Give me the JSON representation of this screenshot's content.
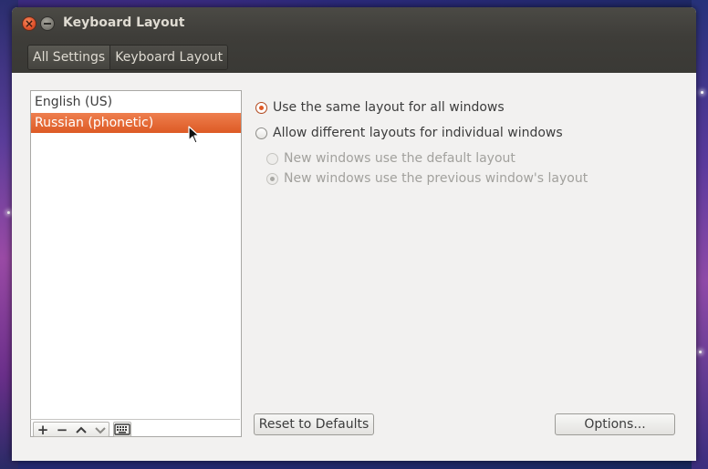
{
  "window": {
    "title": "Keyboard Layout",
    "controls": {
      "close_glyph": "×"
    }
  },
  "breadcrumb": [
    {
      "label": "All Settings"
    },
    {
      "label": "Keyboard Layout"
    }
  ],
  "layouts": {
    "items": [
      {
        "label": "English (US)",
        "selected": false
      },
      {
        "label": "Russian (phonetic)",
        "selected": true
      }
    ],
    "toolbar": {
      "add_label": "+",
      "remove_label": "−",
      "up_label": "⌃",
      "down_label": "⌄"
    }
  },
  "options": {
    "same_layout": {
      "label": "Use the same layout for all windows",
      "checked": true
    },
    "different_layouts": {
      "label": "Allow different layouts for individual windows",
      "checked": false
    },
    "default_layout": {
      "label": "New windows use the default layout",
      "checked": false,
      "enabled": false
    },
    "previous_layout": {
      "label": "New windows use the previous window's layout",
      "checked": true,
      "enabled": false
    }
  },
  "buttons": {
    "reset": "Reset to Defaults",
    "options": "Options..."
  },
  "colors": {
    "accent": "#dd5a24",
    "titlebar": "#3e3d39",
    "window_bg": "#f2f1f0"
  }
}
